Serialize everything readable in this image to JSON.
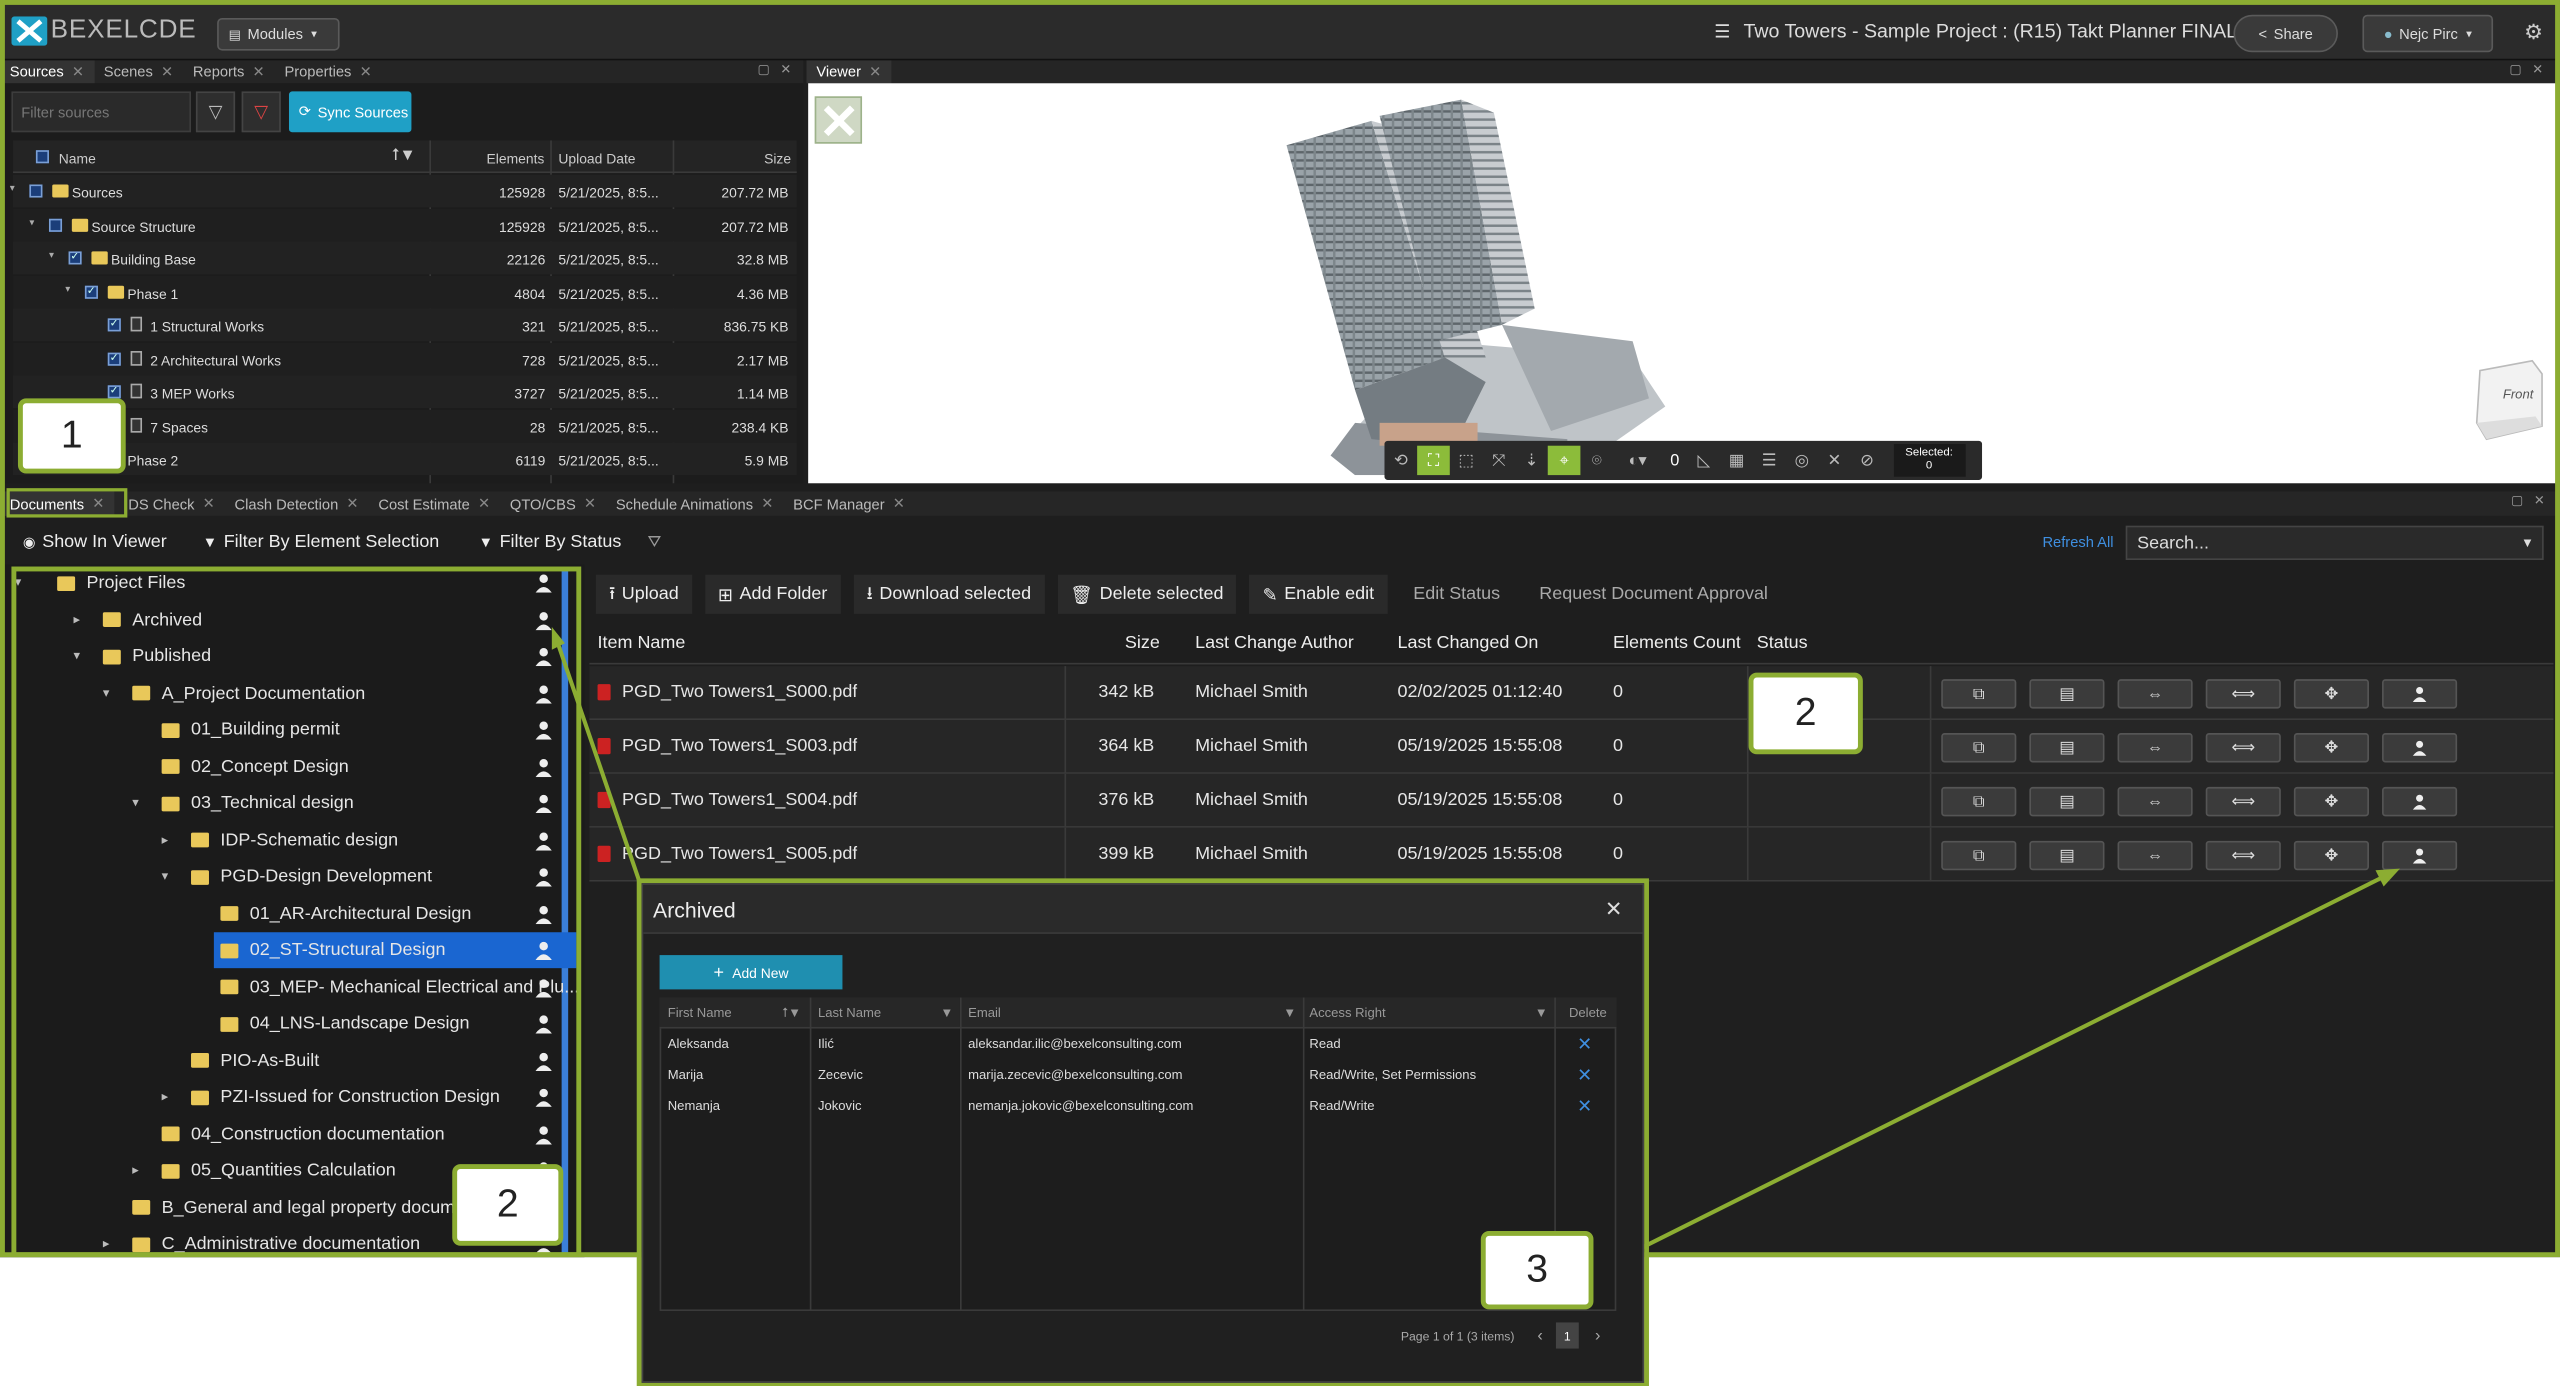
{
  "app": {
    "logo_text": "BEXELCDE",
    "modules_label": "Modules",
    "project_title": "Two Towers - Sample Project : (R15) Takt Planner FINAL",
    "share_label": "Share",
    "user_label": "Nejc Pirc",
    "colors": {
      "accent": "#1fa0c6",
      "callout": "#8cad32",
      "selected": "#1a66d1",
      "folder": "#e9c85a"
    }
  },
  "top_tabs": [
    {
      "label": "Sources"
    },
    {
      "label": "Scenes"
    },
    {
      "label": "Reports"
    },
    {
      "label": "Properties"
    }
  ],
  "viewer_tab": "Viewer",
  "sources": {
    "filter_placeholder": "Filter sources",
    "sync_label": "Sync Sources",
    "columns": {
      "name": "Name",
      "elements": "Elements",
      "upload": "Upload Date",
      "size": "Size"
    },
    "rows": [
      {
        "name": "Sources",
        "elements": "125928",
        "date": "5/21/2025, 8:5...",
        "size": "207.72 MB"
      },
      {
        "name": "Source Structure",
        "elements": "125928",
        "date": "5/21/2025, 8:5...",
        "size": "207.72 MB"
      },
      {
        "name": "Building Base",
        "elements": "22126",
        "date": "5/21/2025, 8:5...",
        "size": "32.8 MB"
      },
      {
        "name": "Phase 1",
        "elements": "4804",
        "date": "5/21/2025, 8:5...",
        "size": "4.36 MB"
      },
      {
        "name": "1 Structural Works",
        "elements": "321",
        "date": "5/21/2025, 8:5...",
        "size": "836.75 KB"
      },
      {
        "name": "2 Architectural Works",
        "elements": "728",
        "date": "5/21/2025, 8:5...",
        "size": "2.17 MB"
      },
      {
        "name": "3 MEP Works",
        "elements": "3727",
        "date": "5/21/2025, 8:5...",
        "size": "1.14 MB"
      },
      {
        "name": "7 Spaces",
        "elements": "28",
        "date": "5/21/2025, 8:5...",
        "size": "238.4 KB"
      },
      {
        "name": "Phase 2",
        "elements": "6119",
        "date": "5/21/2025, 8:5...",
        "size": "5.9 MB"
      }
    ]
  },
  "viewer": {
    "cube_label": "Front",
    "selected_label": "Selected:",
    "selected_count": "0",
    "toolbar_count": "0"
  },
  "bottom_tabs": [
    {
      "label": "Documents"
    },
    {
      "label": "IDS Check"
    },
    {
      "label": "Clash Detection"
    },
    {
      "label": "Cost Estimate"
    },
    {
      "label": "QTO/CBS"
    },
    {
      "label": "Schedule Animations"
    },
    {
      "label": "BCF Manager"
    }
  ],
  "doc_toolbar": {
    "show_in_viewer": "Show In Viewer",
    "filter_element": "Filter By Element Selection",
    "filter_status": "Filter By Status",
    "refresh_all": "Refresh All",
    "search_placeholder": "Search..."
  },
  "tree": [
    {
      "label": "Project Files"
    },
    {
      "label": "Archived"
    },
    {
      "label": "Published"
    },
    {
      "label": "A_Project Documentation"
    },
    {
      "label": "01_Building permit"
    },
    {
      "label": "02_Concept Design"
    },
    {
      "label": "03_Technical design"
    },
    {
      "label": "IDP-Schematic design"
    },
    {
      "label": "PGD-Design Development"
    },
    {
      "label": "01_AR-Architectural Design"
    },
    {
      "label": "02_ST-Structural Design"
    },
    {
      "label": "03_MEP- Mechanical Electrical and Plu..."
    },
    {
      "label": "04_LNS-Landscape Design"
    },
    {
      "label": "PIO-As-Built"
    },
    {
      "label": "PZI-Issued for Construction Design"
    },
    {
      "label": "04_Construction documentation"
    },
    {
      "label": "05_Quantities Calculation"
    },
    {
      "label": "B_General and legal property documentati"
    },
    {
      "label": "C_Administrative documentation"
    }
  ],
  "doc_actions": {
    "upload": "Upload",
    "add_folder": "Add Folder",
    "download": "Download selected",
    "delete": "Delete selected",
    "enable_edit": "Enable edit",
    "edit_status": "Edit Status",
    "request_approval": "Request Document Approval"
  },
  "doc_columns": {
    "name": "Item Name",
    "size": "Size",
    "author": "Last Change Author",
    "changed": "Last Changed On",
    "count": "Elements Count",
    "status": "Status"
  },
  "documents": [
    {
      "name": "PGD_Two Towers1_S000.pdf",
      "size": "342 kB",
      "author": "Michael Smith",
      "changed": "02/02/2025 01:12:40",
      "count": "0"
    },
    {
      "name": "PGD_Two Towers1_S003.pdf",
      "size": "364 kB",
      "author": "Michael Smith",
      "changed": "05/19/2025 15:55:08",
      "count": "0"
    },
    {
      "name": "PGD_Two Towers1_S004.pdf",
      "size": "376 kB",
      "author": "Michael Smith",
      "changed": "05/19/2025 15:55:08",
      "count": "0"
    },
    {
      "name": "PGD_Two Towers1_S005.pdf",
      "size": "399 kB",
      "author": "Michael Smith",
      "changed": "05/19/2025 15:55:08",
      "count": "0"
    }
  ],
  "modal": {
    "title": "Archived",
    "add_new": "Add New",
    "columns": {
      "first": "First Name",
      "last": "Last Name",
      "email": "Email",
      "access": "Access Right",
      "delete": "Delete"
    },
    "rows": [
      {
        "first": "Aleksanda",
        "last": "Ilić",
        "email": "aleksandar.ilic@bexelconsulting.com",
        "access": "Read"
      },
      {
        "first": "Marija",
        "last": "Zecevic",
        "email": "marija.zecevic@bexelconsulting.com",
        "access": "Read/Write, Set Permissions"
      },
      {
        "first": "Nemanja",
        "last": "Jokovic",
        "email": "nemanja.jokovic@bexelconsulting.com",
        "access": "Read/Write"
      }
    ],
    "pager_text": "Page 1 of 1 (3 items)",
    "page": "1"
  },
  "callouts": {
    "c1": "1",
    "c2a": "2",
    "c2b": "2",
    "c3": "3"
  }
}
